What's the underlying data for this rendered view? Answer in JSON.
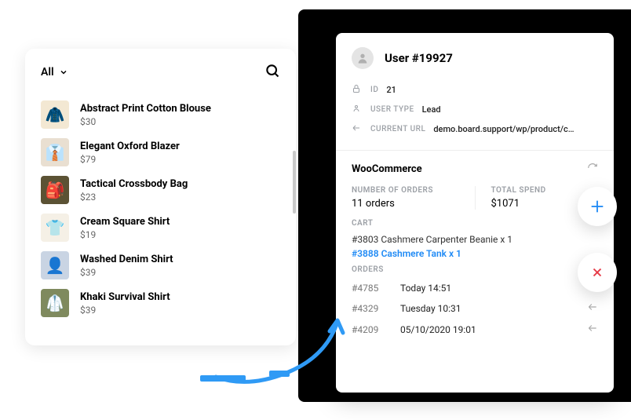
{
  "left": {
    "filter": "All",
    "products": [
      {
        "name": "Abstract Print Cotton Blouse",
        "price": "$30",
        "bg": "#f3e8d3",
        "emoji": "🧥"
      },
      {
        "name": "Elegant Oxford Blazer",
        "price": "$79",
        "bg": "#e9dfd1",
        "emoji": "👔"
      },
      {
        "name": "Tactical Crossbody Bag",
        "price": "$23",
        "bg": "#5b5234",
        "emoji": "🎒"
      },
      {
        "name": "Cream Square Shirt",
        "price": "$19",
        "bg": "#f5f0e6",
        "emoji": "👕"
      },
      {
        "name": "Washed Denim Shirt",
        "price": "$39",
        "bg": "#c9d4e3",
        "emoji": "👤"
      },
      {
        "name": "Khaki Survival Shirt",
        "price": "$39",
        "bg": "#7f8a5e",
        "emoji": "🥼"
      }
    ]
  },
  "right": {
    "title": "User #19927",
    "id_label": "ID",
    "id_value": "21",
    "type_label": "USER TYPE",
    "type_value": "Lead",
    "url_label": "CURRENT URL",
    "url_value": "demo.board.support/wp/product/cash...",
    "woo_title": "WooCommerce",
    "stats": {
      "orders_label": "NUMBER OF ORDERS",
      "orders_value": "11 orders",
      "spend_label": "TOTAL SPEND",
      "spend_value": "$1071"
    },
    "cart_label": "CART",
    "cart": [
      {
        "text": "#3803 Cashmere Carpenter Beanie x 1",
        "link": false
      },
      {
        "text": "#3888 Cashmere Tank x 1",
        "link": true
      }
    ],
    "orders_label": "ORDERS",
    "orders": [
      {
        "id": "#4785",
        "time": "Today 14:51",
        "arrow": false
      },
      {
        "id": "#4329",
        "time": "Tuesday 10:31",
        "arrow": true
      },
      {
        "id": "#4209",
        "time": "05/10/2020 19:01",
        "arrow": true
      }
    ]
  }
}
